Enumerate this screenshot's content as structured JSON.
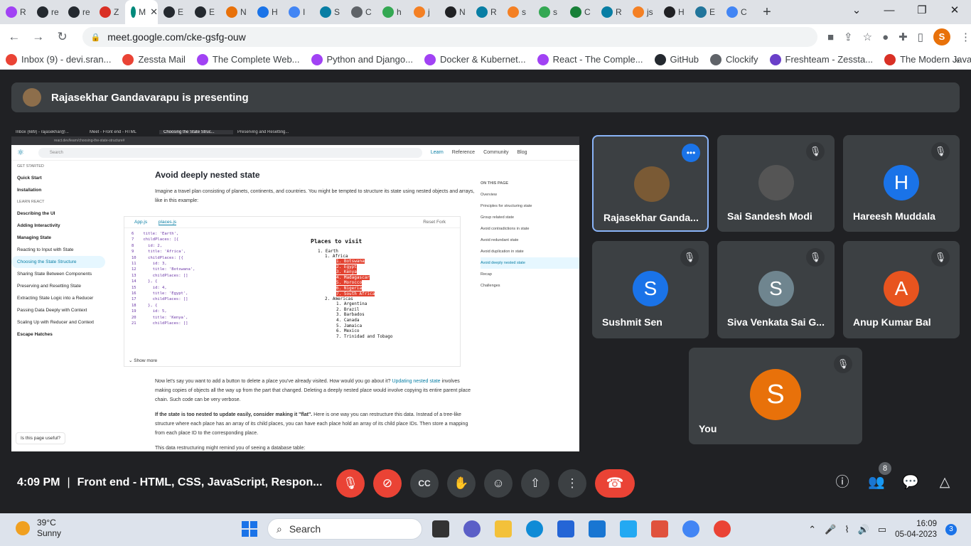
{
  "browser": {
    "tabs": [
      {
        "label": "R",
        "color": "#a142f4"
      },
      {
        "label": "re",
        "color": "#24292f"
      },
      {
        "label": "re",
        "color": "#24292f"
      },
      {
        "label": "Z",
        "color": "#d93025"
      },
      {
        "label": "M",
        "color": "#00897b",
        "active": true
      },
      {
        "label": "E",
        "color": "#24292f"
      },
      {
        "label": "E",
        "color": "#24292f"
      },
      {
        "label": "N",
        "color": "#e8710a"
      },
      {
        "label": "H",
        "color": "#1a73e8"
      },
      {
        "label": "I",
        "color": "#4285f4"
      },
      {
        "label": "S",
        "color": "#087ea4"
      },
      {
        "label": "C",
        "color": "#5f6368"
      },
      {
        "label": "h",
        "color": "#34a853"
      },
      {
        "label": "j",
        "color": "#f48024"
      },
      {
        "label": "N",
        "color": "#202124"
      },
      {
        "label": "R",
        "color": "#087ea4"
      },
      {
        "label": "s",
        "color": "#f48024"
      },
      {
        "label": "s",
        "color": "#34a853"
      },
      {
        "label": "C",
        "color": "#188038"
      },
      {
        "label": "R",
        "color": "#087ea4"
      },
      {
        "label": "js",
        "color": "#f48024"
      },
      {
        "label": "H",
        "color": "#202124"
      },
      {
        "label": "E",
        "color": "#21759b"
      },
      {
        "label": "C",
        "color": "#4285f4"
      }
    ],
    "url": "meet.google.com/cke-gsfg-ouw",
    "profile_initial": "S",
    "bookmarks": [
      {
        "label": "Inbox (9) - devi.sran...",
        "color": "#ea4335"
      },
      {
        "label": "Zessta Mail",
        "color": "#ea4335"
      },
      {
        "label": "The Complete Web...",
        "color": "#a142f4"
      },
      {
        "label": "Python and Django...",
        "color": "#a142f4"
      },
      {
        "label": "Docker & Kubernet...",
        "color": "#a142f4"
      },
      {
        "label": "React - The Comple...",
        "color": "#a142f4"
      },
      {
        "label": "GitHub",
        "color": "#24292f"
      },
      {
        "label": "Clockify",
        "color": "#5f6368"
      },
      {
        "label": "Freshteam - Zessta...",
        "color": "#6a3fc9"
      },
      {
        "label": "The Modern JavaSc...",
        "color": "#d93025"
      }
    ]
  },
  "meet": {
    "presenter_banner": "Rajasekhar Gandavarapu is presenting",
    "shared": {
      "tabs": [
        "Inbox (689) - rajasekhar@...",
        "Meet - Front end - HTML",
        "Choosing the State Struc...",
        "Preserving and Resetting..."
      ],
      "url": "react.dev/learn/choosing-the-state-structure#",
      "search_placeholder": "Search",
      "nav": [
        "Learn",
        "Reference",
        "Community",
        "Blog"
      ],
      "sidebar": [
        {
          "label": "GET STARTED",
          "kind": "sec"
        },
        {
          "label": "Quick Start",
          "kind": "b"
        },
        {
          "label": "Installation",
          "kind": "b"
        },
        {
          "label": "LEARN REACT",
          "kind": "sec"
        },
        {
          "label": "Describing the UI",
          "kind": "b"
        },
        {
          "label": "Adding Interactivity",
          "kind": "b"
        },
        {
          "label": "Managing State",
          "kind": "b"
        },
        {
          "label": "Reacting to Input with State",
          "kind": ""
        },
        {
          "label": "Choosing the State Structure",
          "kind": "hl"
        },
        {
          "label": "Sharing State Between Components",
          "kind": ""
        },
        {
          "label": "Preserving and Resetting State",
          "kind": ""
        },
        {
          "label": "Extracting State Logic into a Reducer",
          "kind": ""
        },
        {
          "label": "Passing Data Deeply with Context",
          "kind": ""
        },
        {
          "label": "Scaling Up with Reducer and Context",
          "kind": ""
        },
        {
          "label": "Escape Hatches",
          "kind": "b"
        }
      ],
      "feedback": "Is this page useful?",
      "heading": "Avoid deeply nested state",
      "intro": "Imagine a travel plan consisting of planets, continents, and countries. You might be tempted to structure its state using nested objects and arrays, like in this example:",
      "code_tabs": [
        "App.js",
        "places.js"
      ],
      "code_actions": "Reset   Fork",
      "code": "6    title: 'Earth',\n7    childPlaces: [{\n8      id: 2,\n9      title: 'Africa',\n10     childPlaces: [{\n11       id: 3,\n12       title: 'Botswana',\n13       childPlaces: []\n14     }, {\n15       id: 4,\n16       title: 'Egypt',\n17       childPlaces: []\n18     }, {\n19       id: 5,\n20       title: 'Kenya',\n21       childPlaces: []",
      "preview_title": "Places to visit",
      "preview_earth": "1. Earth",
      "preview_africa": "1. Africa",
      "preview_africa_list": [
        "1. Botswana",
        "2. Egypt",
        "3. Kenya",
        "4. Madagascar",
        "5. Morocco",
        "6. Nigeria",
        "7. South Africa"
      ],
      "preview_americas": "2. Americas",
      "preview_americas_list": [
        "1. Argentina",
        "2. Brazil",
        "3. Barbados",
        "4. Canada",
        "5. Jamaica",
        "6. Mexico",
        "7. Trinidad and Tobago"
      ],
      "show_more": "Show more",
      "para1": "Now let's say you want to add a button to delete a place you've already visited. How would you go about it?",
      "para1_link": "Updating nested state",
      "para1b": "involves making copies of objects all the way up from the part that changed. Deleting a deeply nested place would involve copying its entire parent place chain. Such code can be very verbose.",
      "para2_bold": "If the state is too nested to update easily, consider making it \"flat\".",
      "para2": "Here is one way you can restructure this data. Instead of a tree-like structure where each place has an array of its child places, you can have each place hold an array of its child place IDs. Then store a mapping from each place ID to the corresponding place.",
      "para3": "This data restructuring might remind you of seeing a database table:",
      "on_this_page_title": "ON THIS PAGE",
      "on_this_page": [
        "Overview",
        "Principles for structuring state",
        "Group related state",
        "Avoid contradictions in state",
        "Avoid redundant state",
        "Avoid duplication in state",
        "Avoid deeply nested state",
        "Recap",
        "Challenges"
      ]
    },
    "participants": [
      {
        "name": "Rajasekhar Ganda...",
        "initial": "",
        "color": "#7a5a35",
        "speaking": true
      },
      {
        "name": "Sai Sandesh Modi",
        "initial": "",
        "color": "#555"
      },
      {
        "name": "Hareesh Muddala",
        "initial": "H",
        "color": "#1a73e8"
      },
      {
        "name": "Sushmit Sen",
        "initial": "S",
        "color": "#1a73e8"
      },
      {
        "name": "Siva Venkata Sai G...",
        "initial": "S",
        "color": "#6f858f"
      },
      {
        "name": "Anup Kumar Bal",
        "initial": "A",
        "color": "#e8541f"
      },
      {
        "name": "You",
        "initial": "S",
        "color": "#e8710a"
      }
    ],
    "time": "4:09 PM",
    "separator": "|",
    "meeting_title": "Front end - HTML, CSS, JavaScript, Respon...",
    "people_count": "8"
  },
  "taskbar": {
    "temperature": "39°C",
    "condition": "Sunny",
    "search_label": "Search",
    "time": "16:09",
    "date": "05-04-2023",
    "notifications": "3"
  }
}
